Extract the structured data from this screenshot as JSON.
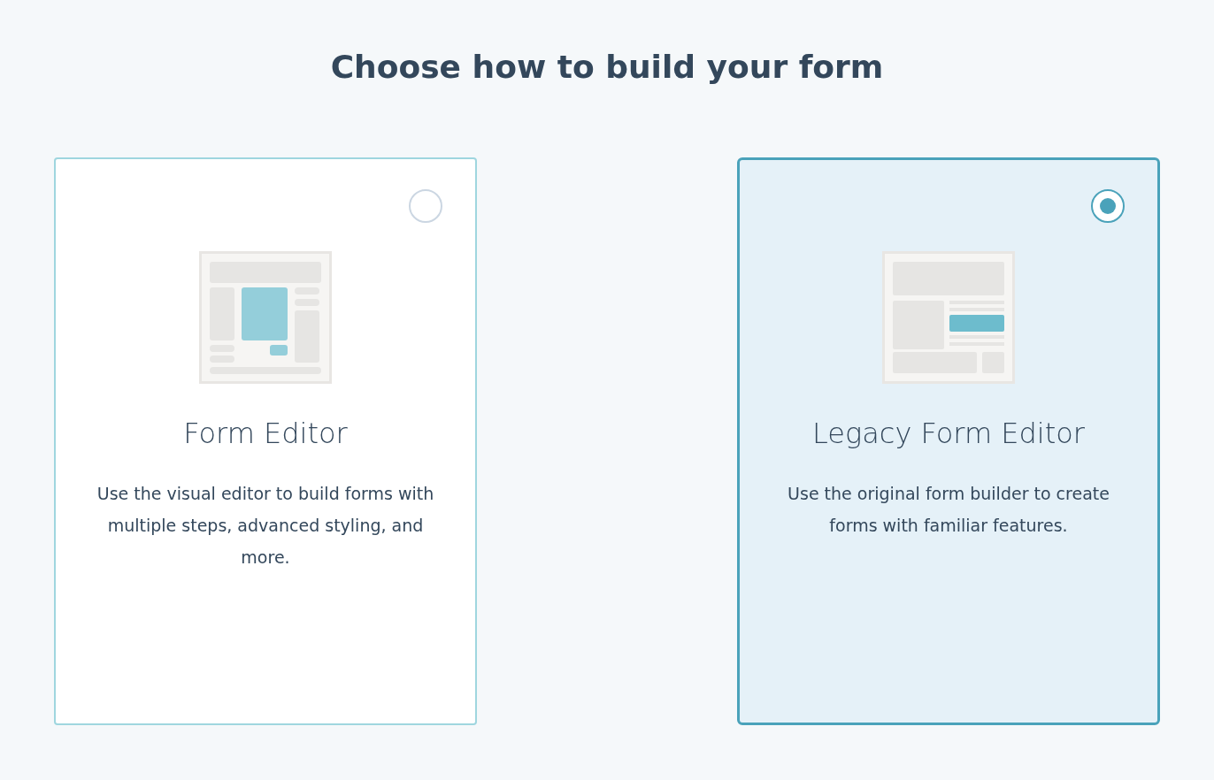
{
  "heading": "Choose how to build your form",
  "options": [
    {
      "kind": "visual",
      "title": "Form Editor",
      "description": "Use the visual editor to build forms with multiple steps, advanced styling, and more.",
      "selected": false
    },
    {
      "kind": "legacy",
      "title": "Legacy Form Editor",
      "description": "Use the original form builder to create forms with familiar features.",
      "selected": true
    }
  ]
}
